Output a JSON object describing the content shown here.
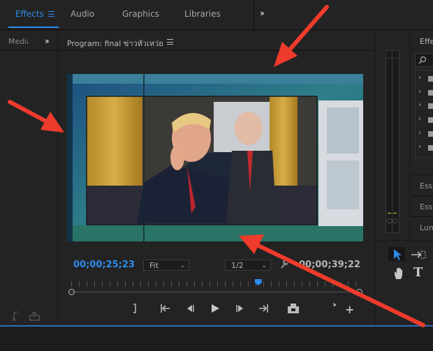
{
  "workspaces": {
    "tabs": [
      {
        "label": "Effects",
        "active": true
      },
      {
        "label": "Audio",
        "active": false
      },
      {
        "label": "Graphics",
        "active": false
      },
      {
        "label": "Libraries",
        "active": false
      }
    ],
    "overflow_icon": "chevron-double-right-icon"
  },
  "media_panel": {
    "title": "Media"
  },
  "program_monitor": {
    "title": "Program: final ข่าวหัวเหว่ย",
    "menu_icon": "hamburger-menu-icon",
    "current_timecode": "00;00;25;23",
    "duration_timecode": "00;00;39;22",
    "zoom_select": {
      "value": "Fit"
    },
    "resolution_select": {
      "value": "1/2"
    },
    "playhead_position": 0.65,
    "transport": [
      "mark-in-icon",
      "go-to-in-icon",
      "step-back-icon",
      "play-icon",
      "step-forward-icon",
      "go-to-out-icon",
      "export-frame-icon"
    ],
    "extra_buttons": [
      "chevron-double-right-icon",
      "plus-icon"
    ]
  },
  "effects_panel": {
    "title": "Effe",
    "search_icon": "search-icon",
    "folders": 6,
    "sections": [
      "Esse",
      "Esse",
      "Lum"
    ]
  },
  "tools": [
    "selection-tool-icon",
    "ripple-edit-icon",
    "hand-tool-icon",
    "type-tool-icon"
  ],
  "colors": {
    "accent": "#2d8ceb",
    "annotation_arrow": "#ee3b2b",
    "panel": "#232323",
    "background": "#1d1d1d"
  }
}
